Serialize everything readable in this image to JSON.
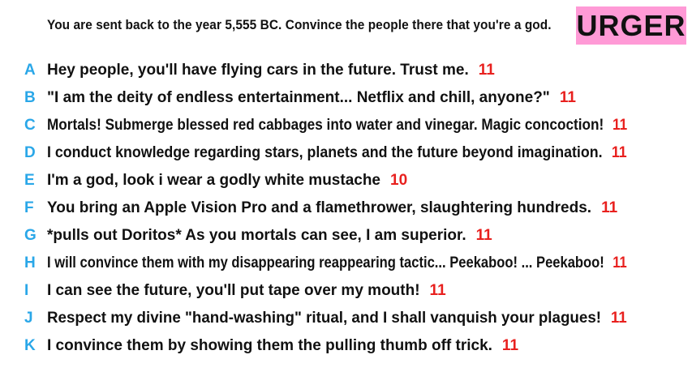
{
  "prompt": "You are sent back to the year 5,555 BC. Convince the people there that you're a god.",
  "badge": {
    "label": "URGER",
    "color": "#ff9ad6"
  },
  "colors": {
    "letter": "#2aa7e8",
    "score": "#e8201e"
  },
  "answers": [
    {
      "letter": "A",
      "text": "Hey people, you'll have flying cars in the future. Trust me.",
      "score": "11"
    },
    {
      "letter": "B",
      "text": "\"I am the deity of endless entertainment... Netflix and chill, anyone?\"",
      "score": "11"
    },
    {
      "letter": "C",
      "text": "Mortals! Submerge blessed red cabbages into water and vinegar. Magic concoction!",
      "score": "11"
    },
    {
      "letter": "D",
      "text": "I conduct knowledge regarding stars, planets and the future beyond imagination.",
      "score": "11"
    },
    {
      "letter": "E",
      "text": "I'm a god, look i wear a godly white mustache",
      "score": "10"
    },
    {
      "letter": "F",
      "text": "You bring an Apple Vision Pro and a flamethrower, slaughtering hundreds.",
      "score": "11"
    },
    {
      "letter": "G",
      "text": "*pulls out Doritos* As you mortals can see, I am superior.",
      "score": "11"
    },
    {
      "letter": "H",
      "text": "I will convince them with my disappearing reappearing tactic... Peekaboo! ... Peekaboo!",
      "score": "11"
    },
    {
      "letter": "I",
      "text": "I can see the future, you'll put tape over my mouth!",
      "score": "11"
    },
    {
      "letter": "J",
      "text": "Respect my divine \"hand-washing\" ritual, and I shall vanquish your plagues!",
      "score": "11"
    },
    {
      "letter": "K",
      "text": "I convince them by showing them the pulling thumb off trick.",
      "score": "11"
    }
  ]
}
